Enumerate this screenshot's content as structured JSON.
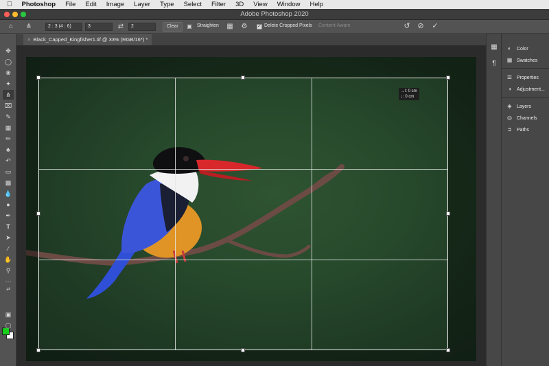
{
  "menubar": {
    "apple": "",
    "app_name": "Photoshop",
    "items": [
      "File",
      "Edit",
      "Image",
      "Layer",
      "Type",
      "Select",
      "Filter",
      "3D",
      "View",
      "Window",
      "Help"
    ]
  },
  "window": {
    "title": "Adobe Photoshop 2020"
  },
  "options": {
    "ratio_select": "2 : 3 (4 : 6)",
    "width_value": "3",
    "height_value": "2",
    "clear_label": "Clear",
    "straighten_label": "Straighten",
    "delete_cropped_label": "Delete Cropped Pixels",
    "delete_cropped_checked": true,
    "content_aware_label": "Content-Aware"
  },
  "document": {
    "tab_label": "Black_Capped_Kingfisher1.tif @ 33% (RGB/16*) *"
  },
  "crop_readout": {
    "width": "→l: 0 cm",
    "height": "↓: 0 cm"
  },
  "tools": [
    "move",
    "marquee",
    "lasso",
    "magic-wand",
    "crop",
    "frame",
    "eyedropper",
    "healing",
    "brush",
    "stamp",
    "history-brush",
    "eraser",
    "gradient",
    "blur",
    "dodge",
    "pen",
    "type",
    "path-select",
    "shape",
    "hand",
    "zoom",
    "more"
  ],
  "colors": {
    "foreground": "#16d11a",
    "background": "#ffffff"
  },
  "panels": {
    "group1": [
      "Color",
      "Swatches"
    ],
    "group2": [
      "Properties",
      "Adjustment..."
    ],
    "group3": [
      "Layers",
      "Channels",
      "Paths"
    ]
  }
}
